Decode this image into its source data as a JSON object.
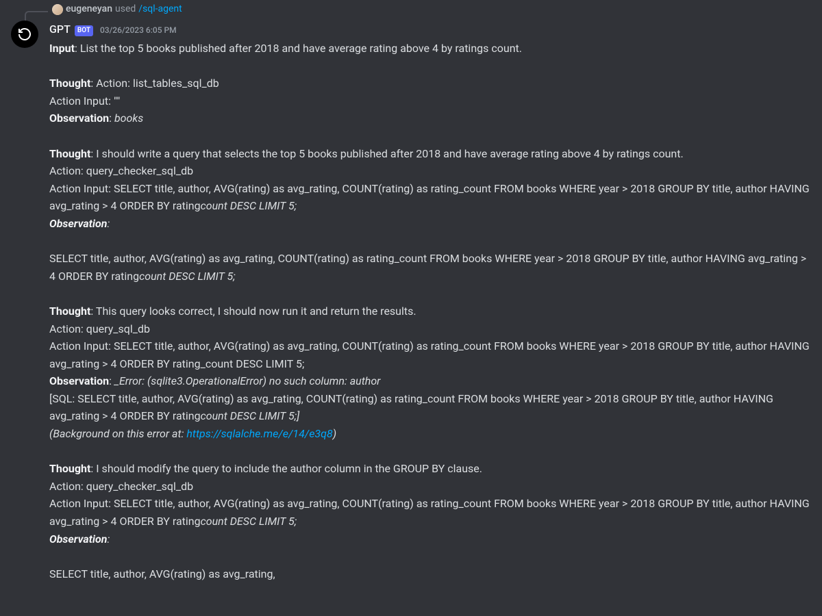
{
  "reply": {
    "username": "eugeneyan",
    "used_text": " used",
    "command": " /sql-agent"
  },
  "author": {
    "name": "GPT",
    "bot_tag": "BOT"
  },
  "timestamp": "03/26/2023 6:05 PM",
  "body": {
    "l1a": "Input",
    "l1b": ": List the top 5 books published after 2018 and have average rating above 4 by ratings count.",
    "l2a": "Thought",
    "l2b": ": Action: list_tables_sql_db",
    "l3": "Action Input: \"\"",
    "l4a": "Observation",
    "l4b": ": ",
    "l4c": "books",
    "l5a": "Thought",
    "l5b": ": I should write a query that selects the top 5 books published after 2018 and have average rating above 4 by ratings count.",
    "l6": "Action: query_checker_sql_db",
    "l7a": "Action Input: SELECT title, author, AVG(rating) as avg_rating, COUNT(rating) as rating_count FROM books WHERE year > 2018 GROUP BY title, author HAVING avg_rating > 4 ORDER BY rating",
    "l7b": "count DESC LIMIT 5;",
    "l8a": "Observation",
    "l8b": ":",
    "l9a": "SELECT title, author, AVG(rating) as avg_rating, COUNT(rating) as rating_count FROM books WHERE year > 2018 GROUP BY title, author HAVING avg_rating > 4 ORDER BY rating",
    "l9b": "count DESC LIMIT 5;",
    "l10a": "Thought",
    "l10b": ": This query looks correct, I should now run it and return the results.",
    "l11": "Action: query_sql_db",
    "l12": "Action Input: SELECT title, author, AVG(rating) as avg_rating, COUNT(rating) as rating_count FROM books WHERE year > 2018 GROUP BY title, author HAVING avg_rating > 4 ORDER BY rating_count DESC LIMIT 5;",
    "l13a": "Observation",
    "l13b": ": ",
    "l13c": "_Error: (sqlite3.OperationalError) no such column: author",
    "l14a": "[SQL: SELECT title, author, AVG(rating) as avg_rating, COUNT(rating) as rating_count FROM books WHERE year > 2018 GROUP BY title, author HAVING avg_rating > 4 ORDER BY rating",
    "l14b": "count DESC LIMIT 5;]",
    "l15a": "(Background on this error at: ",
    "l15b": "https://sqlalche.me/e/14/e3q8",
    "l15c": ")",
    "l16a": "Thought",
    "l16b": ": I should modify the query to include the author column in the GROUP BY clause.",
    "l17": "Action: query_checker_sql_db",
    "l18a": "Action Input: SELECT title, author, AVG(rating) as avg_rating, COUNT(rating) as rating_count FROM books WHERE year > 2018 GROUP BY title, author HAVING avg_rating > 4 ORDER BY rating",
    "l18b": "count DESC LIMIT 5;",
    "l19a": "Observation",
    "l19b": ":",
    "l20": "SELECT title, author, AVG(rating) as avg_rating,"
  }
}
